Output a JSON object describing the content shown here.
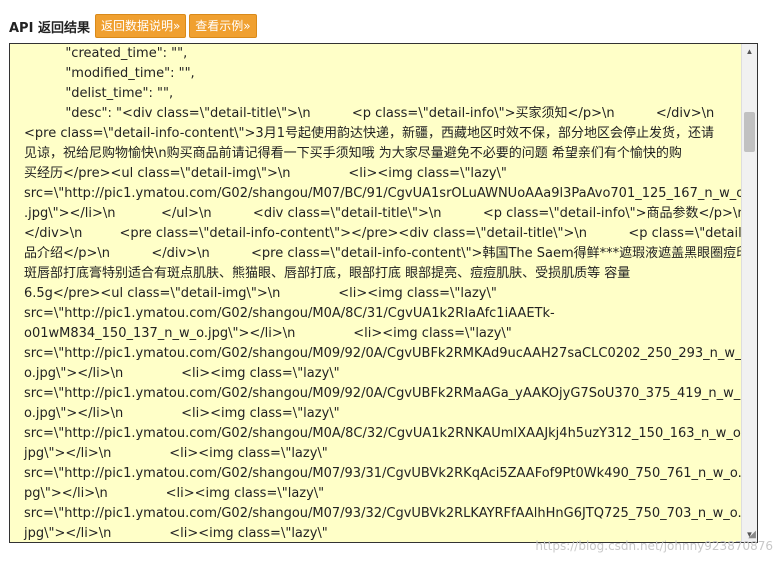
{
  "header": {
    "title": "API 返回结果",
    "btn_explain": "返回数据说明»",
    "btn_example": "查看示例»"
  },
  "result": {
    "lines": [
      "          \"created_time\": \"\",",
      "          \"modified_time\": \"\",",
      "          \"delist_time\": \"\",",
      "          \"desc\": \"<div class=\\\"detail-title\\\">\\n          <p class=\\\"detail-info\\\">买家须知</p>\\n          </div>\\n",
      "<pre class=\\\"detail-info-content\\\">3月1号起使用韵达快递，新疆，西藏地区时效不保，部分地区会停止发货，还请",
      "见谅，祝给尼购物愉快\\n购买商品前请记得看一下买手须知哦 为大家尽量避免不必要的问题 希望亲们有个愉快的购",
      "买经历</pre><ul class=\\\"detail-img\\\">\\n              <li><img class=\\\"lazy\\\"",
      "src=\\\"http://pic1.ymatou.com/G02/shangou/M07/BC/91/CgvUA1srOLuAWNUoAAa9l3PaAvo701_125_167_n_w_o",
      ".jpg\\\"></li>\\n           </ul>\\n          <div class=\\\"detail-title\\\">\\n          <p class=\\\"detail-info\\\">商品参数</p>\\n",
      "</div>\\n         <pre class=\\\"detail-info-content\\\"></pre><div class=\\\"detail-title\\\">\\n          <p class=\\\"detail-info\\\">商",
      "品介绍</p>\\n          </div>\\n          <pre class=\\\"detail-info-content\\\">韩国The Saem得鲜***遮瑕液遮盖黑眼圈痘印雀",
      "斑唇部打底膏特别适合有斑点肌肤、熊猫眼、唇部打底，眼部打底 眼部提亮、痘痘肌肤、受损肌质等 容量",
      "6.5g</pre><ul class=\\\"detail-img\\\">\\n              <li><img class=\\\"lazy\\\"",
      "src=\\\"http://pic1.ymatou.com/G02/shangou/M0A/8C/31/CgvUA1k2RIaAfc1iAAETk-",
      "o01wM834_150_137_n_w_o.jpg\\\"></li>\\n              <li><img class=\\\"lazy\\\"",
      "src=\\\"http://pic1.ymatou.com/G02/shangou/M09/92/0A/CgvUBFk2RMKAd9ucAAH27saCLC0202_250_293_n_w_",
      "o.jpg\\\"></li>\\n              <li><img class=\\\"lazy\\\"",
      "src=\\\"http://pic1.ymatou.com/G02/shangou/M09/92/0A/CgvUBFk2RMaAGa_yAAKOjyG7SoU370_375_419_n_w_",
      "o.jpg\\\"></li>\\n              <li><img class=\\\"lazy\\\"",
      "src=\\\"http://pic1.ymatou.com/G02/shangou/M0A/8C/32/CgvUA1k2RNKAUmIXAAJkj4h5uzY312_150_163_n_w_o.",
      "jpg\\\"></li>\\n              <li><img class=\\\"lazy\\\"",
      "src=\\\"http://pic1.ymatou.com/G02/shangou/M07/93/31/CgvUBVk2RKqAci5ZAAFof9Pt0Wk490_750_761_n_w_o.j",
      "pg\\\"></li>\\n              <li><img class=\\\"lazy\\\"",
      "src=\\\"http://pic1.ymatou.com/G02/shangou/M07/93/32/CgvUBVk2RLKAYRFfAAlhHnG6JTQ725_750_703_n_w_o.",
      "jpg\\\"></li>\\n              <li><img class=\\\"lazy\\\""
    ]
  },
  "watermark": "https://blog.csdn.net/johnny923870876"
}
